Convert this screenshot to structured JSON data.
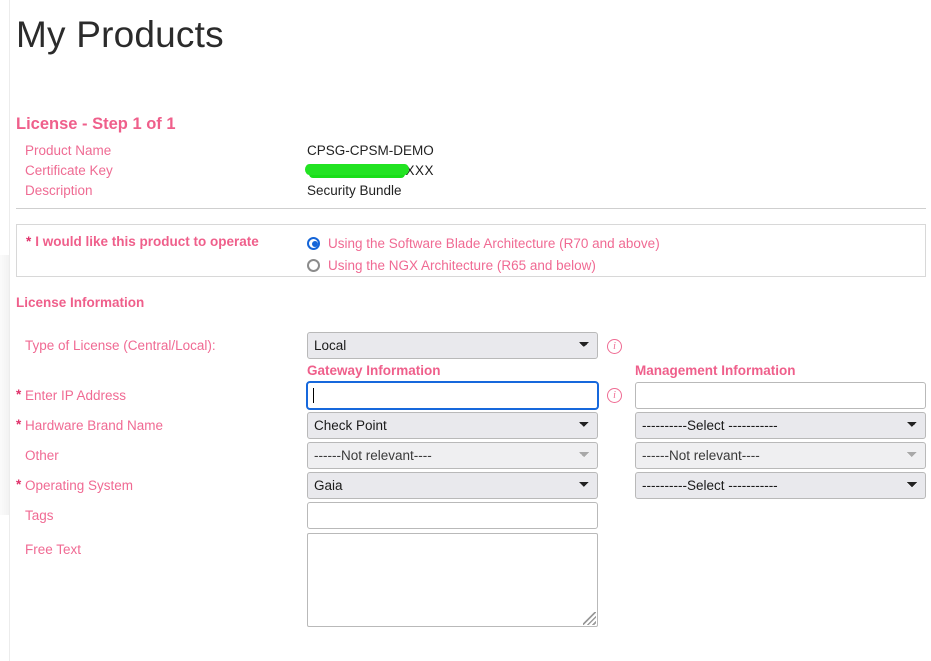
{
  "page": {
    "title": "My Products"
  },
  "step": {
    "heading": "License - Step 1 of 1"
  },
  "summary": {
    "rows": [
      {
        "label": "Product Name",
        "value": "CPSG-CPSM-DEMO",
        "redacted": false
      },
      {
        "label": "Certificate Key",
        "value": "4XXXXXX-XXXXXX",
        "redacted": true
      },
      {
        "label": "Description",
        "value": "Security Bundle",
        "redacted": false
      }
    ]
  },
  "operate": {
    "required_marker": "*",
    "label": "I would like this product to operate",
    "options": [
      {
        "label": "Using the Software Blade Architecture (R70 and above)",
        "selected": true
      },
      {
        "label": "Using the NGX Architecture (R65 and below)",
        "selected": false
      }
    ]
  },
  "license_info": {
    "heading": "License Information",
    "columns": {
      "gateway": "Gateway Information",
      "management": "Management Information"
    },
    "required_marker": "*",
    "fields": [
      {
        "label": "Type of License (Central/Local):",
        "required": false,
        "gateway": {
          "control": "select",
          "value": "Local"
        },
        "info": true
      },
      {
        "label": "Enter IP Address",
        "required": true,
        "gateway": {
          "control": "input",
          "value": "",
          "placeholder": "",
          "focused": true
        },
        "management": {
          "control": "input",
          "value": "",
          "placeholder": ""
        },
        "info": true
      },
      {
        "label": "Hardware Brand Name",
        "required": true,
        "gateway": {
          "control": "select",
          "value": "Check Point"
        },
        "management": {
          "control": "select",
          "value": "----------Select -----------"
        }
      },
      {
        "label": "Other",
        "required": false,
        "gateway": {
          "control": "select",
          "value": "------Not relevant----",
          "disabled": true
        },
        "management": {
          "control": "select",
          "value": "------Not relevant----",
          "disabled": true
        }
      },
      {
        "label": "Operating System",
        "required": true,
        "gateway": {
          "control": "select",
          "value": "Gaia"
        },
        "management": {
          "control": "select",
          "value": "----------Select -----------"
        }
      },
      {
        "label": "Tags",
        "required": false,
        "gateway": {
          "control": "input",
          "value": "",
          "placeholder": ""
        }
      },
      {
        "label": "Free Text",
        "required": false,
        "gateway": {
          "control": "textarea",
          "value": "",
          "placeholder": ""
        }
      }
    ]
  },
  "icons": {
    "info": "i"
  },
  "colors": {
    "accent_pink": "#ef5f8b",
    "label_pink": "#f06a93",
    "required_red": "#e0316a",
    "focus_blue": "#1668dc",
    "redaction_green": "#22e322"
  }
}
